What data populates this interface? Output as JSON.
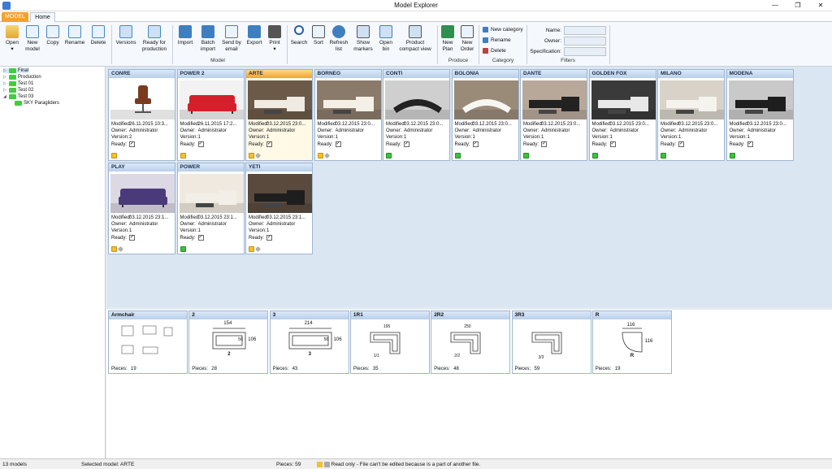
{
  "window": {
    "title": "Model Explorer",
    "minimize": "—",
    "maximize": "❐",
    "close": "✕"
  },
  "tabs": {
    "model": "MODEL",
    "home": "Home"
  },
  "ribbon": {
    "open": "Open",
    "open_arrow": "▾",
    "new_model": "New model",
    "copy": "Copy",
    "rename": "Rename",
    "delete": "Delete",
    "versions": "Versions",
    "ready_for_production": "Ready for production",
    "import": "Import",
    "batch_import": "Batch import",
    "send_by_email": "Send by email",
    "export": "Export",
    "print": "Print",
    "print_arrow": "▾",
    "search": "Search",
    "sort": "Sort",
    "refresh_list": "Refresh list",
    "show_markers": "Show markers",
    "open_bin": "Open bin",
    "product_compact_view": "Product compact view",
    "new_plan": "New Plan",
    "new_order": "New Order",
    "cat_new": "New category",
    "cat_rename": "Rename",
    "cat_delete": "Delete",
    "filter_name": "Name:",
    "filter_owner": "Owner:",
    "filter_spec": "Specification:",
    "group_model": "Model",
    "group_produce": "Produce",
    "group_category": "Category",
    "group_filters": "Filters"
  },
  "tree": {
    "final": "Final",
    "production": "Production",
    "test01": "Test 01",
    "test02": "Test 02",
    "test03": "Test 03",
    "sky": "SKY Paragliders"
  },
  "labels": {
    "modified": "Modified:",
    "owner": "Owner:",
    "version": "Version:",
    "ready": "Ready:",
    "pieces": "Pieces:",
    "check": "✓"
  },
  "models": [
    {
      "name": "CONRE",
      "modified": "26.11.2015 10:3...",
      "owner": "Administrator",
      "version": "2",
      "badges": [
        "lock"
      ]
    },
    {
      "name": "POWER 2",
      "modified": "26.11.2015 17:2...",
      "owner": "Administrator",
      "version": "1",
      "badges": [
        "lock"
      ]
    },
    {
      "name": "ARTE",
      "modified": "03.12.2015 23:0...",
      "owner": "Administrator",
      "version": "1",
      "badges": [
        "lock",
        "key"
      ]
    },
    {
      "name": "BORNEO",
      "modified": "03.12.2015 23:0...",
      "owner": "Administrator",
      "version": "1",
      "badges": [
        "lock",
        "key"
      ]
    },
    {
      "name": "CONTI",
      "modified": "03.12.2015 23:0...",
      "owner": "Administrator",
      "version": "1",
      "badges": [
        "ok"
      ]
    },
    {
      "name": "BOLONIA",
      "modified": "03.12.2015 23:0...",
      "owner": "Administrator",
      "version": "1",
      "badges": [
        "ok"
      ]
    },
    {
      "name": "DANTE",
      "modified": "03.12.2015 23:0...",
      "owner": "Administrator",
      "version": "1",
      "badges": [
        "ok"
      ]
    },
    {
      "name": "GOLDEN FOX",
      "modified": "03.12.2015 23:0...",
      "owner": "Administrator",
      "version": "1",
      "badges": [
        "ok"
      ]
    },
    {
      "name": "MILANO",
      "modified": "03.12.2015 23:0...",
      "owner": "Administrator",
      "version": "1",
      "badges": [
        "ok"
      ]
    },
    {
      "name": "MODENA",
      "modified": "03.12.2015 23:0...",
      "owner": "Administrator",
      "version": "1",
      "badges": [
        "ok"
      ]
    },
    {
      "name": "PLAY",
      "modified": "03.12.2015 23:1...",
      "owner": "Administrator",
      "version": "1",
      "badges": [
        "lock",
        "key"
      ]
    },
    {
      "name": "POWER",
      "modified": "03.12.2015 23:1...",
      "owner": "Administrator",
      "version": "1",
      "badges": [
        "ok"
      ]
    },
    {
      "name": "YETI",
      "modified": "03.12.2015 23:1...",
      "owner": "Administrator",
      "version": "1",
      "badges": [
        "lock",
        "key"
      ]
    }
  ],
  "pieces": [
    {
      "name": "Armchair",
      "count": "19",
      "dims": []
    },
    {
      "name": "2",
      "count": "28",
      "dims": [
        "154",
        "106",
        "56",
        "2"
      ]
    },
    {
      "name": "3",
      "count": "43",
      "dims": [
        "214",
        "106",
        "56",
        "3"
      ]
    },
    {
      "name": "1R1",
      "count": "35",
      "dims": [
        "195",
        "1/1"
      ]
    },
    {
      "name": "2R2",
      "count": "48",
      "dims": [
        "250",
        "2/2"
      ]
    },
    {
      "name": "3R3",
      "count": "59",
      "dims": [
        "3/3"
      ]
    },
    {
      "name": "R",
      "count": "19",
      "dims": [
        "116",
        "116",
        "R"
      ]
    }
  ],
  "status": {
    "models_count": "13 models",
    "selected": "Selected model: ARTE",
    "pieces": "Pieces: 59",
    "readonly": "Read only - File can't be edited because is a part of another file."
  }
}
